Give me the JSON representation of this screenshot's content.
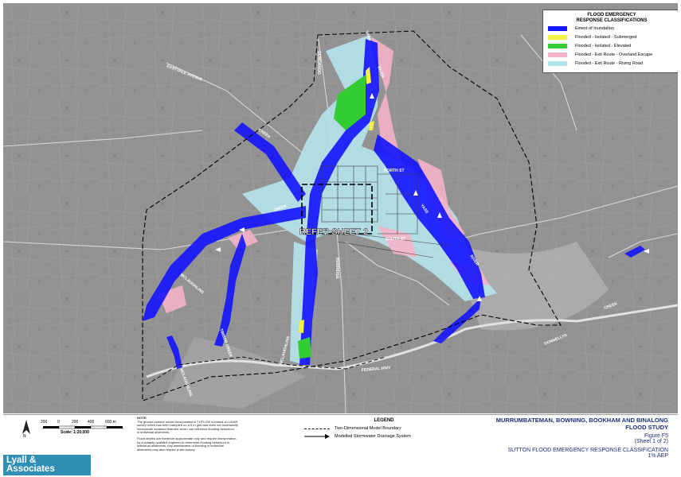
{
  "legend": {
    "title": "FLOOD EMERGENCY\nRESPONSE CLASSIFICATIONS",
    "items": [
      {
        "label": "Extent of Inundation",
        "color": "#1414ff"
      },
      {
        "label": "Flooded - Isolated - Submerged",
        "color": "#f2f24a"
      },
      {
        "label": "Flooded - Isolated - Elevated",
        "color": "#33cc33"
      },
      {
        "label": "Flooded - Exit Route - Overland Escape",
        "color": "#f5b3c8"
      },
      {
        "label": "Flooded - Exit Route - Rising Road",
        "color": "#b5e3ec"
      }
    ]
  },
  "map": {
    "refer_label": "REFER SHEET 2",
    "road_labels": [
      "EASTVALE AVENUE",
      "YASS",
      "RIVER",
      "FEDERAL HWY",
      "CREEK",
      "YASS",
      "RIVER",
      "CREEK",
      "MCLAUGHLINS",
      "MCLAUGHLINS",
      "TIMBER CREEK",
      "DONNELLYS",
      "GUNDAROO",
      "CREEK",
      "MCLAUGHLINS",
      "BURRIDGE",
      "NORTH ST",
      "SOUTH ST"
    ]
  },
  "scale": {
    "labels": [
      "200",
      "0",
      "200",
      "400",
      "600 m"
    ],
    "text": "Scale: 1:20,000"
  },
  "note": {
    "title": "NOTE:",
    "lines": [
      "The ground surface model incorporated in TUFLOW is based on LiDAR",
      "survey which has been sampled on a 5 m grid and does not necessarily",
      "incorporate localised features which can influence flooding behaviour",
      "in individual allotments.",
      "",
      "Flood depths are therefore approximate only and require interpretation",
      "by a suitably qualified engineer to determine flooding behaviour in",
      "individual allotments. Any assessment of flooding in individual",
      "allotments may also require a site survey."
    ]
  },
  "legend2": {
    "title": "LEGEND",
    "items": [
      {
        "label": "Two-Dimensional Model Boundary",
        "style": "dashed"
      },
      {
        "label": "Modelled Stormwater Drainage System",
        "style": "arrow"
      }
    ]
  },
  "title_block": {
    "study_line1": "MURRUMBATEMAN, BOWNING, BOOKHAM AND BINALONG",
    "study_line2": "FLOOD STUDY",
    "figure": "Figure F5",
    "sheet": "(Sheet 1 of 2)",
    "figure_title": "SUTTON FLOOD EMERGENCY RESPONSE CLASSIFICATION",
    "aep": "1% AEP"
  },
  "logo": {
    "text": "Lyall &\nAssociates"
  },
  "north_arrow": "north-arrow-icon",
  "colors": {
    "inundation": "#1414ff",
    "rising_road": "#b5e3ec",
    "overland": "#f5b3c8",
    "elevated": "#33cc33",
    "submerged": "#f2f24a",
    "boundary": "#000000",
    "title_blue": "#1c2e7e",
    "logo_bg": "#2f8fb7"
  }
}
